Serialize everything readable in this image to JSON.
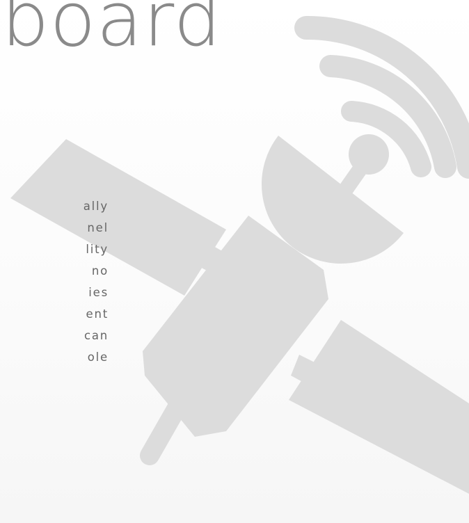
{
  "heading": {
    "text": "board"
  },
  "paragraph": {
    "lines": [
      "ally",
      "nel",
      "lity",
      "no",
      "ies",
      "ent",
      "can",
      "ole"
    ]
  },
  "graphic": {
    "name": "satellite-icon",
    "color": "#dcdcdc"
  },
  "colors": {
    "heading": "#8a8a8a",
    "body_text": "#666666",
    "background": "#fbfbfb"
  }
}
